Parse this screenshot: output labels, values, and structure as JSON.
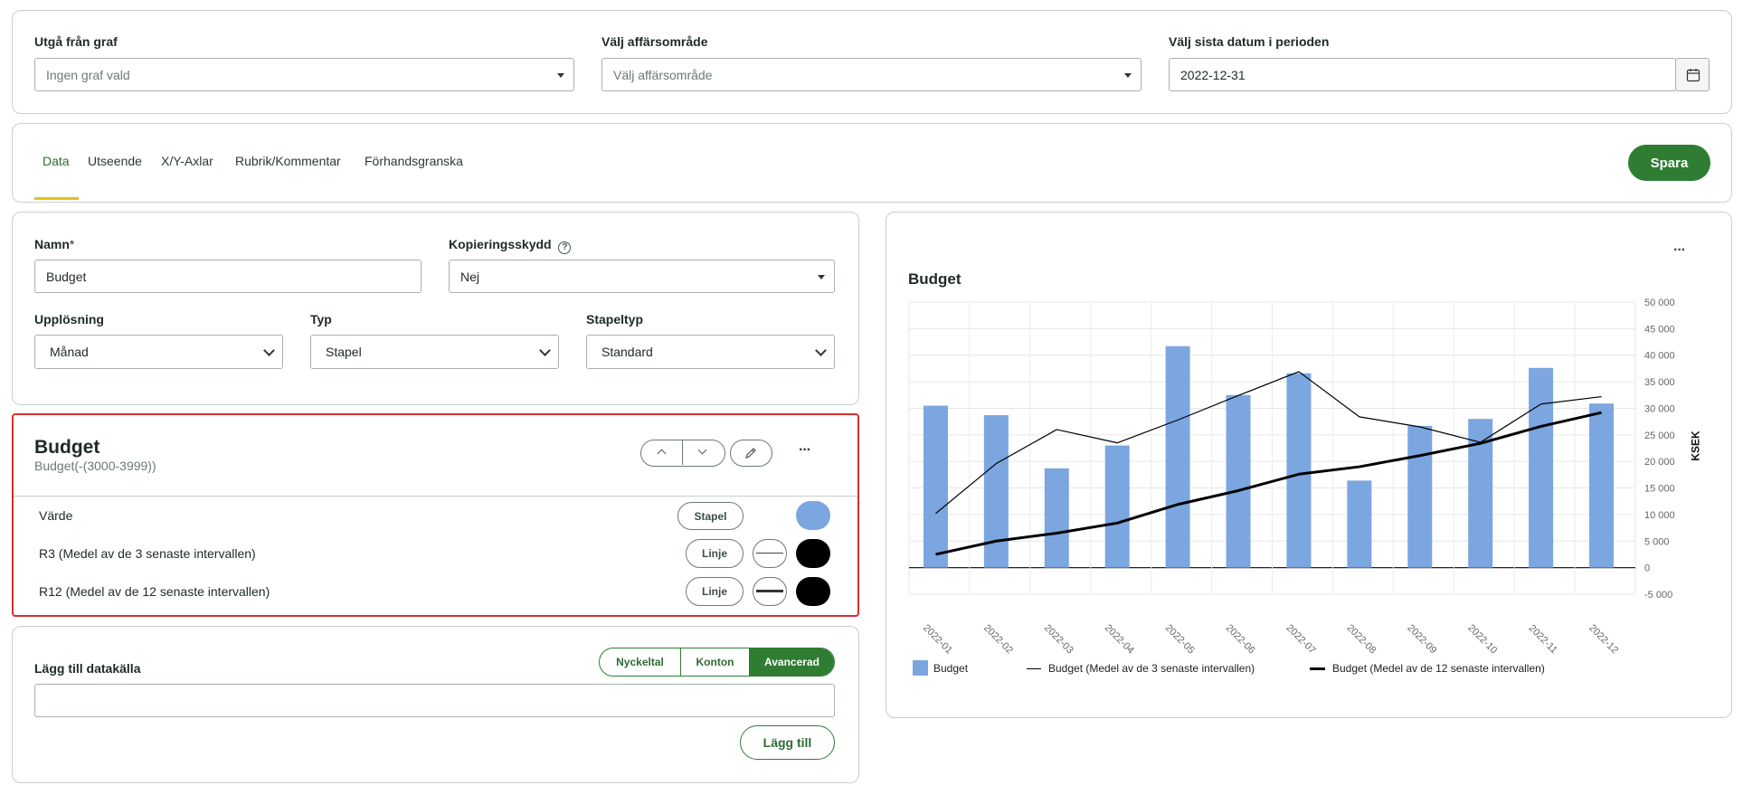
{
  "filters": {
    "graph": {
      "label": "Utgå från graf",
      "placeholder": "Ingen graf vald"
    },
    "area": {
      "label": "Välj affärsområde",
      "placeholder": "Välj affärsområde"
    },
    "date": {
      "label": "Välj sista datum i perioden",
      "value": "2022-12-31"
    }
  },
  "tabs": [
    "Data",
    "Utseende",
    "X/Y-Axlar",
    "Rubrik/Kommentar",
    "Förhandsgranska"
  ],
  "active_tab": "Data",
  "save_label": "Spara",
  "form": {
    "name_label": "Namn",
    "name_required": "*",
    "name_value": "Budget",
    "copy_label": "Kopieringsskydd",
    "copy_value": "Nej",
    "resolution_label": "Upplösning",
    "resolution_value": "Månad",
    "type_label": "Typ",
    "type_value": "Stapel",
    "bartype_label": "Stapeltyp",
    "bartype_value": "Standard"
  },
  "series_card": {
    "title": "Budget",
    "subtitle": "Budget(-(3000-3999))",
    "rows": [
      {
        "label": "Värde",
        "type": "Stapel",
        "color": "#7ba6e0"
      },
      {
        "label": "R3 (Medel av de 3 senaste intervallen)",
        "type": "Linje",
        "color": "#000000"
      },
      {
        "label": "R12 (Medel av de 12 senaste intervallen)",
        "type": "Linje",
        "color": "#000000"
      }
    ]
  },
  "datasource": {
    "label": "Lägg till datakälla",
    "toggles": [
      "Nyckeltal",
      "Konton",
      "Avancerad"
    ],
    "active_toggle": "Avancerad",
    "add_label": "Lägg till"
  },
  "colors": {
    "accent": "#2e7d32",
    "tab_underline": "#e0c21c",
    "highlight_border": "#d32f2f",
    "bar": "#7ba6e0"
  },
  "chart_menu": "···",
  "chart_data": {
    "type": "bar",
    "title": "Budget",
    "ylabel": "KSEK",
    "categories": [
      "2022-01",
      "2022-02",
      "2022-03",
      "2022-04",
      "2022-05",
      "2022-06",
      "2022-07",
      "2022-08",
      "2022-09",
      "2022-10",
      "2022-11",
      "2022-12"
    ],
    "ylim": [
      -5000,
      50000
    ],
    "yticks": [
      -5000,
      0,
      5000,
      10000,
      15000,
      20000,
      25000,
      30000,
      35000,
      40000,
      45000,
      50000
    ],
    "ytick_labels": [
      "-5 000",
      "0",
      "5 000",
      "10 000",
      "15 000",
      "20 000",
      "25 000",
      "30 000",
      "35 000",
      "40 000",
      "45 000",
      "50 000"
    ],
    "grid": true,
    "legend": "bottom",
    "series": [
      {
        "name": "Budget",
        "kind": "bar",
        "color": "#7ba6e0",
        "values": [
          30500,
          28700,
          18700,
          23000,
          41700,
          32500,
          36600,
          16400,
          26700,
          28000,
          37600,
          30900
        ]
      },
      {
        "name": "Budget (Medel av de 3 senaste intervallen)",
        "kind": "line",
        "color": "#000000",
        "weight": "thin",
        "values": [
          10200,
          19600,
          26000,
          23500,
          27800,
          32400,
          36900,
          28400,
          26500,
          23600,
          30800,
          32200
        ]
      },
      {
        "name": "Budget (Medel av de 12 senaste intervallen)",
        "kind": "line",
        "color": "#000000",
        "weight": "thick",
        "values": [
          2500,
          5000,
          6500,
          8400,
          11900,
          14500,
          17600,
          19000,
          21100,
          23400,
          26600,
          29200
        ]
      }
    ]
  }
}
